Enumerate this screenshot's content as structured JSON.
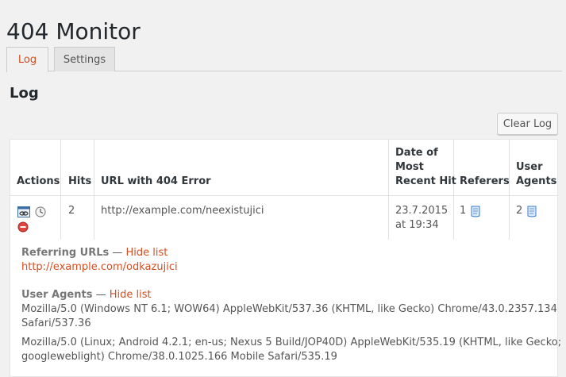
{
  "page": {
    "title": "404 Monitor"
  },
  "tabs": [
    {
      "label": "Log",
      "active": true
    },
    {
      "label": "Settings",
      "active": false
    }
  ],
  "section": {
    "title": "Log"
  },
  "toolbar": {
    "clear_label": "Clear Log"
  },
  "table": {
    "headers": {
      "actions": "Actions",
      "hits": "Hits",
      "url": "URL with 404 Error",
      "date_line1": "Date of",
      "date_line2": "Most",
      "date_line3": "Recent Hit",
      "referers": "Referers",
      "ua_line1": "User",
      "ua_line2": "Agents"
    },
    "rows": [
      {
        "hits": "2",
        "url": "http://example.com/neexistujici",
        "date_line1": "23.7.2015",
        "date_line2": "at 19:34",
        "referers": "1",
        "user_agents": "2",
        "action_icons": [
          "browser-link-icon",
          "clock-icon",
          "delete-icon"
        ]
      }
    ]
  },
  "details": {
    "referring_label": "Referring URLs",
    "dash1": " — ",
    "hide1": "Hide list",
    "referring_urls": [
      "http://example.com/odkazujici"
    ],
    "ua_label": "User Agents",
    "dash2": " — ",
    "hide2": "Hide list",
    "ua_1_line1": "Mozilla/5.0 (Windows NT 6.1; WOW64) AppleWebKit/537.36 (KHTML, like Gecko) Chrome/43.0.2357.134",
    "ua_1_line2": "Safari/537.36",
    "ua_2_line1": "Mozilla/5.0 (Linux; Android 4.2.1; en-us; Nexus 5 Build/JOP40D) AppleWebKit/535.19 (KHTML, like Gecko;",
    "ua_2_line2": "googleweblight) Chrome/38.0.1025.166 Mobile Safari/535.19"
  },
  "colors": {
    "accent": "#d54e21",
    "background": "#f1f1f1"
  }
}
